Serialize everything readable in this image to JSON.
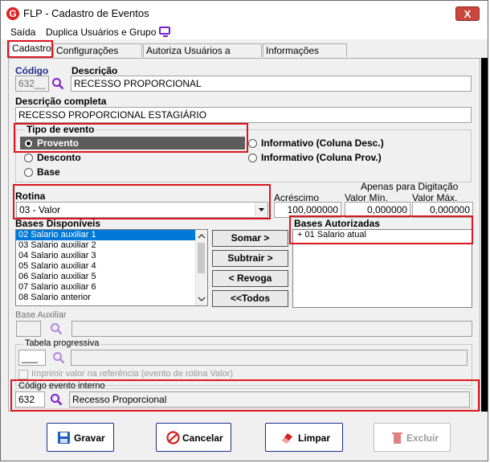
{
  "window": {
    "title": "FLP - Cadastro de Eventos",
    "close_label": "X"
  },
  "menu": {
    "items": [
      "Saída",
      "Duplica Usuários e Grupo"
    ]
  },
  "tabs": [
    "Cadastro",
    "Configurações Legais",
    "Autoriza Usuários a Variáveis",
    "Informações eSocial"
  ],
  "form": {
    "codigo_label": "Código",
    "codigo_value": "632__",
    "descricao_label": "Descrição",
    "descricao_value": "RECESSO PROPORCIONAL",
    "descricao_completa_label": "Descrição completa",
    "descricao_completa_value": "RECESSO PROPORCIONAL ESTAGIÁRIO",
    "tipo_evento_label": "Tipo de evento",
    "tipo_options": [
      "Provento",
      "Desconto",
      "Base",
      "Informativo (Coluna Desc.)",
      "Informativo (Coluna Prov.)"
    ],
    "tipo_selected": "Provento",
    "rotina_label": "Rotina",
    "rotina_value": "03 - Valor",
    "apenas_label": "Apenas para Digitação",
    "acrescimo_label": "Acréscimo",
    "acrescimo_value": "100,000000",
    "valor_min_label": "Valor Mín.",
    "valor_min_value": "0,000000",
    "valor_max_label": "Valor Máx.",
    "valor_max_value": "0,000000",
    "bases_disponiveis_label": "Bases Disponíveis",
    "bases_disponiveis": [
      "02 Salario auxiliar 1",
      "03 Salario auxiliar 2",
      "04 Salario auxiliar 3",
      "05 Salario auxiliar 4",
      "06 Salario auxiliar 5",
      "07 Salario auxiliar 6",
      "08 Salario anterior"
    ],
    "bases_autorizadas_label": "Bases Autorizadas",
    "bases_autorizadas": [
      "+ 01 Salario atual"
    ],
    "btn_somar": "Somar >",
    "btn_subtrair": "Subtrair >",
    "btn_revoga": "< Revoga",
    "btn_todos": "<<Todos",
    "base_auxiliar_label": "Base Auxiliar",
    "tabela_progressiva_label": "Tabela progressiva",
    "tabela_progressiva_value": "___",
    "imprimir_label": "Imprimir valor na referência (evento de rotina Valor)",
    "codigo_interno_label": "Código evento interno",
    "codigo_interno_value": "632",
    "codigo_interno_desc": "Recesso Proporcional"
  },
  "actions": {
    "gravar": "Gravar",
    "cancelar": "Cancelar",
    "limpar": "Limpar",
    "excluir": "Excluir"
  },
  "colors": {
    "highlight": "#d9161c",
    "accent": "#1a2b8c",
    "search_icon": "#7a1fd0",
    "selection": "#0078d7"
  }
}
